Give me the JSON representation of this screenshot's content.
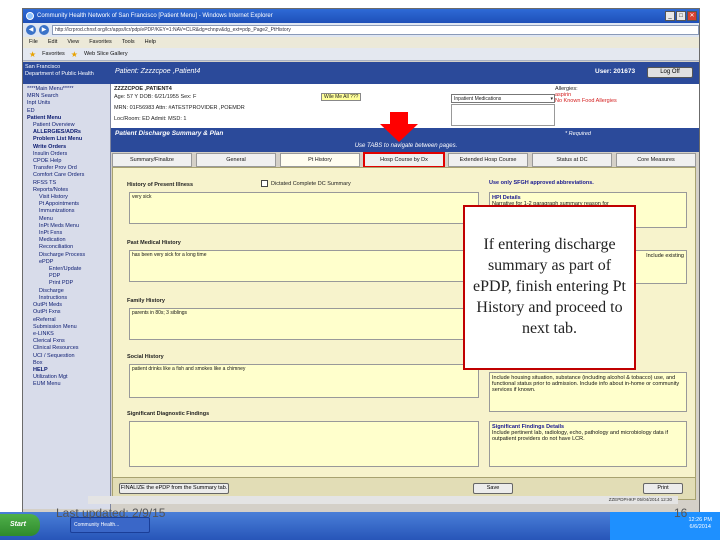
{
  "browser": {
    "title": "Community Health Network of San Francisco [Patient Menu] - Windows Internet Explorer",
    "address": "http://lcrprod.chnsf.org/lcr/apps/lcr/pdp/ePDP/KEY=1:NAV=CLR&dg=chnpv&dg_ext=pdp_Page2_PtHistory",
    "window_buttons": [
      "_",
      "□",
      "✕"
    ],
    "menu": [
      "File",
      "Edit",
      "View",
      "Favorites",
      "Tools",
      "Help"
    ],
    "favorites": [
      "Favorites",
      "Web Slice Gallery"
    ]
  },
  "app": {
    "org_line1": "San Francisco",
    "org_line2": "Department of Public Health",
    "patient_label": "Patient: Zzzzcpoe ,Patient4",
    "user_label": "User: 201673",
    "logoff": "Log Off"
  },
  "left_menu": [
    {
      "label": "****Main Menu*****",
      "level": 1
    },
    {
      "label": "MRN Search",
      "level": 1
    },
    {
      "label": "Inpt Units",
      "level": 1
    },
    {
      "label": "ED",
      "level": 1
    },
    {
      "label": "Patient Menu",
      "level": 1
    },
    {
      "label": "Patient Overview",
      "level": 2
    },
    {
      "label": "ALLERGIES/ADRs",
      "level": 2
    },
    {
      "label": "Problem List Menu",
      "level": 2
    },
    {
      "label": "Write Orders",
      "level": 2
    },
    {
      "label": "Insulin Orders",
      "level": 2
    },
    {
      "label": "CPOE Help",
      "level": 2
    },
    {
      "label": "Transfer Prov Ord",
      "level": 2
    },
    {
      "label": "Comfort Care Orders",
      "level": 2
    },
    {
      "label": "RFSS TS",
      "level": 2
    },
    {
      "label": "Reports/Notes",
      "level": 2
    },
    {
      "label": "Visit History",
      "level": 3
    },
    {
      "label": "Pt Appointments",
      "level": 3
    },
    {
      "label": "Immunizations",
      "level": 3
    },
    {
      "label": "Menu",
      "level": 3
    },
    {
      "label": "InPt Meds Menu",
      "level": 3
    },
    {
      "label": "InPt Fxns",
      "level": 3
    },
    {
      "label": "Medication",
      "level": 3
    },
    {
      "label": "Reconciliation",
      "level": 3
    },
    {
      "label": "Discharge Process",
      "level": 3
    },
    {
      "label": "ePDP",
      "level": 3
    },
    {
      "label": "Enter/Update",
      "level": 4
    },
    {
      "label": "PDP",
      "level": 4
    },
    {
      "label": "Print PDP",
      "level": 4
    },
    {
      "label": "Discharge",
      "level": 3
    },
    {
      "label": "Instructions",
      "level": 3
    },
    {
      "label": "OutPt Meds",
      "level": 2
    },
    {
      "label": "OutPt Fxns",
      "level": 2
    },
    {
      "label": "eReferral",
      "level": 2
    },
    {
      "label": "Submission Menu",
      "level": 2
    },
    {
      "label": "e-LINKS",
      "level": 2
    },
    {
      "label": "Clerical Fxns",
      "level": 2
    },
    {
      "label": "Clinical Resources",
      "level": 2
    },
    {
      "label": "UCI / Sequestion",
      "level": 2
    },
    {
      "label": "Box",
      "level": 2
    },
    {
      "label": "HELP",
      "level": 2
    },
    {
      "label": "Utilization Mgt",
      "level": 2
    },
    {
      "label": "EUM Menu",
      "level": 2
    }
  ],
  "patient_info": {
    "name": "ZZZZCPOE ,PATIENT4",
    "age": "Age:     57 Y     DOB:    6/21/1955          Sex:    F",
    "mrn": "MRN:     01F56983          Attn:   #ATESTPROVIDER ,POEMDR",
    "loc": "Loc/Room:    ED          Admit:                      MSD:   1  ",
    "status_chip": "Wile Me All ???",
    "med_select": "Inpatient Medications",
    "allergies_label": "Allergies:",
    "allergy_items": [
      "aspirin",
      "No Known Food Allergies"
    ]
  },
  "section": {
    "title": "Patient Discharge Summary & Plan",
    "required": "* Required",
    "hint": "Use TABS to navigate between pages."
  },
  "tabs": [
    {
      "label": "Summary/Finalize"
    },
    {
      "label": "General"
    },
    {
      "label": "Pt History"
    },
    {
      "label": "Hosp Course by Dx"
    },
    {
      "label": "Extended Hosp Course"
    },
    {
      "label": "Status at DC"
    },
    {
      "label": "Core Measures"
    }
  ],
  "form": {
    "hpi_label": "History of Present Illness",
    "dictated_label": "Dictated Complete DC Summary",
    "hpi_value": "very sick",
    "abbrev_note": "Use only SFGH approved abbreviations.",
    "hpi_help_title": "HPI Details",
    "hpi_help_text": "Narrative for 1-2 paragraph summary reason for",
    "pmh_label": "Past Medical History",
    "pmh_value": "has been very sick for a long time",
    "pmh_help_text": "Include existing",
    "fh_label": "Family History",
    "fh_value": "parents in 80s; 3 siblings",
    "sh_label": "Social History",
    "sh_value": "patient drinks like a fish and smokes like a chimney",
    "sh_help_text": "Include housing situation, substance (including alcohol & tobacco) use, and functional status prior to admission. Include info about in-home or community services if known.",
    "sdf_label": "Significant Diagnostic Findings",
    "sdf_help_title": "Significant Findings Details",
    "sdf_help_text": "Include pertinent lab, radiology, echo, pathology and microbiology data if outpatient providers do not have LCR.",
    "finalize_note": "FINALIZE the ePDP from the Summary tab.",
    "save": "Save",
    "print": "Print"
  },
  "statusbar": "ZZEPDPHKP   05/04/2014 12:30",
  "taskbar": {
    "start": "Start",
    "item": "Community Health...",
    "clock_time": "12:26 PM",
    "clock_date": "6/6/2014"
  },
  "slide": {
    "callout": "If entering discharge summary as part of ePDP, finish entering Pt History and proceed to next tab.",
    "last_updated": "Last updated: 2/9/15",
    "slide_number": "16"
  }
}
